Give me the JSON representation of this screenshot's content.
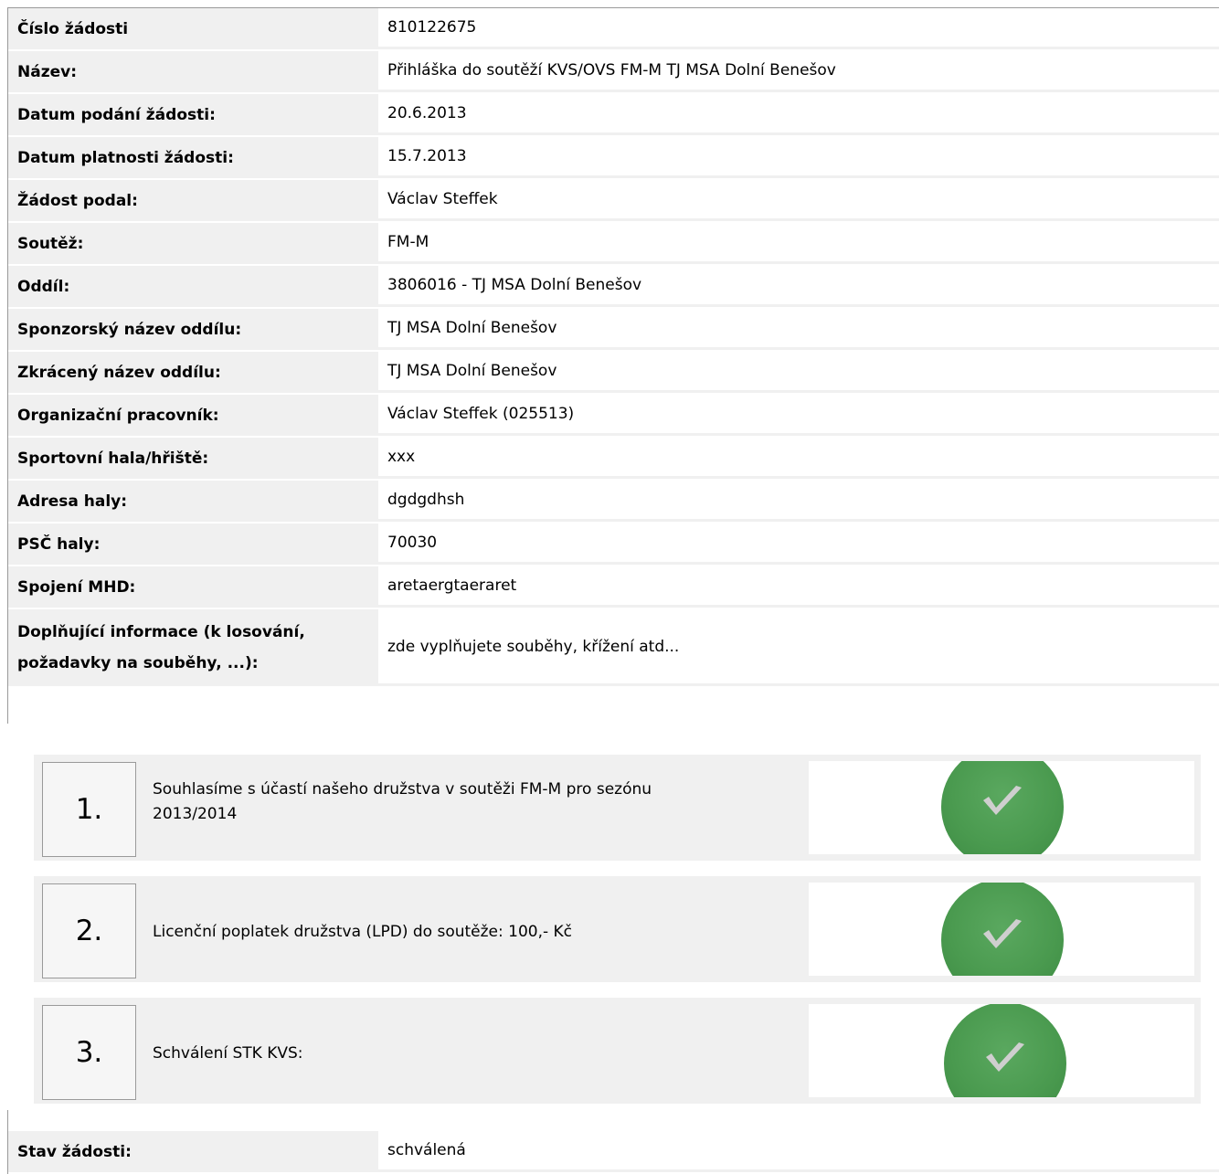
{
  "rows": [
    {
      "label": "Číslo žádosti",
      "value": "810122675"
    },
    {
      "label": "Název:",
      "value": "Přihláška do soutěží KVS/OVS FM-M  TJ MSA Dolní Benešov"
    },
    {
      "label": "Datum podání žádosti:",
      "value": "20.6.2013"
    },
    {
      "label": "Datum platnosti žádosti:",
      "value": "15.7.2013"
    },
    {
      "label": "Žádost podal:",
      "value": "Václav Steffek"
    },
    {
      "label": "Soutěž:",
      "value": "FM-M"
    },
    {
      "label": "Oddíl:",
      "value": "3806016 - TJ MSA Dolní Benešov"
    },
    {
      "label": "Sponzorský název oddílu:",
      "value": "TJ MSA Dolní Benešov"
    },
    {
      "label": "Zkrácený název oddílu:",
      "value": "TJ MSA Dolní Benešov"
    },
    {
      "label": "Organizační pracovník:",
      "value": "Václav Steffek (025513)"
    },
    {
      "label": "Sportovní hala/hřiště:",
      "value": "xxx"
    },
    {
      "label": "Adresa haly:",
      "value": "dgdgdhsh"
    },
    {
      "label": "PSČ haly:",
      "value": "70030"
    },
    {
      "label": "Spojení MHD:",
      "value": "aretaergtaeraret"
    },
    {
      "label": "Doplňující informace (k losování, požadavky na souběhy, ...):",
      "value": "zde vyplňujete souběhy, křížení atd..."
    }
  ],
  "steps": [
    {
      "number": "1.",
      "text": "Souhlasíme s účastí našeho družstva v soutěži  FM-M  pro sezónu 2013/2014",
      "status_icon": "check-icon"
    },
    {
      "number": "2.",
      "text": "Licenční poplatek družstva (LPD) do soutěže: 100,- Kč",
      "status_icon": "check-icon"
    },
    {
      "number": "3.",
      "text": "Schválení STK KVS:",
      "status_icon": "check-icon"
    }
  ],
  "status": {
    "label": "Stav žádosti:",
    "value": "schválená"
  },
  "colors": {
    "check_green": "#4a9a4f",
    "row_label_bg": "#f0f0f0",
    "border": "#9a9a9a"
  }
}
